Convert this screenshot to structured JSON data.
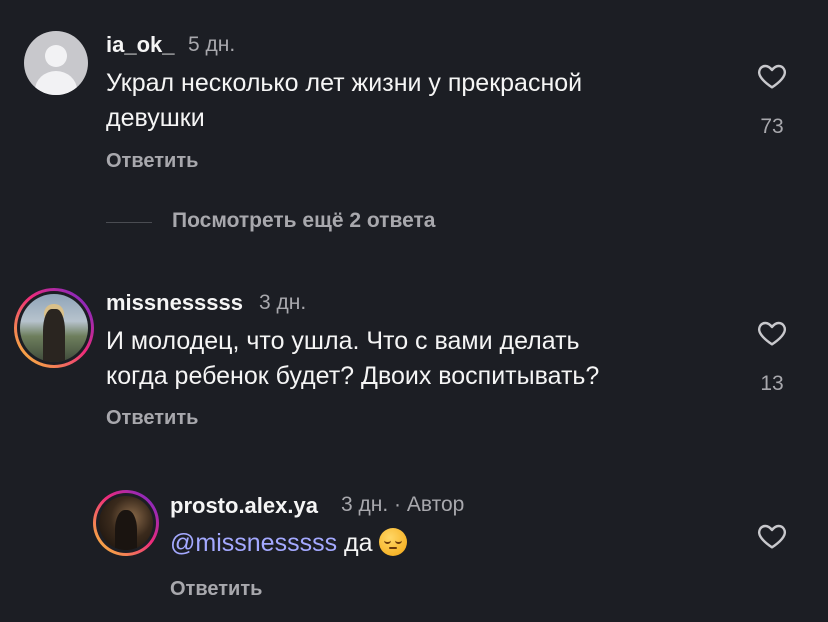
{
  "comments": [
    {
      "username": "ia_ok_",
      "time": "5 дн.",
      "text_line1": "Украл несколько лет жизни у прекрасной",
      "text_line2": "девушки",
      "likes": "73",
      "reply_label": "Ответить"
    },
    {
      "username": "missnesssss",
      "time": "3 дн.",
      "text_line1": "И молодец, что ушла. Что с вами делать",
      "text_line2": "когда ребенок будет? Двоих воспитывать?",
      "likes": "13",
      "reply_label": "Ответить"
    }
  ],
  "view_more_replies": "Посмотреть ещё 2 ответа",
  "reply": {
    "username": "prosto.alex.ya",
    "time": "3 дн. · Автор",
    "mention": "@missnesssss",
    "text": "да",
    "emoji": "pensive-face",
    "reply_label": "Ответить"
  },
  "colors": {
    "background": "#1c1e24",
    "mention": "#a4a9ff",
    "secondary_text": "#a8a8ad"
  }
}
